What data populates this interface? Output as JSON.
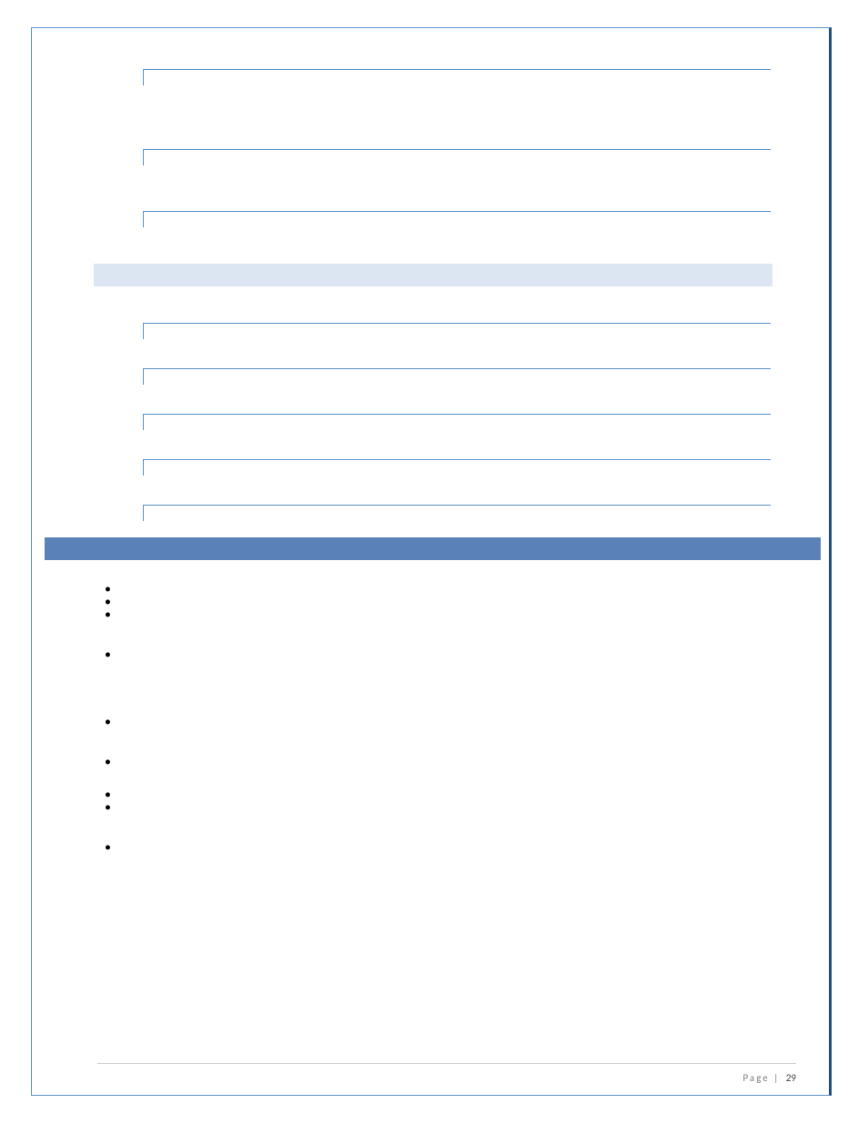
{
  "fields_group_a": [
    {
      "value": ""
    },
    {
      "value": ""
    },
    {
      "value": ""
    }
  ],
  "subheader": {
    "label": ""
  },
  "fields_group_b": [
    {
      "value": ""
    },
    {
      "value": ""
    },
    {
      "value": ""
    },
    {
      "value": ""
    },
    {
      "value": ""
    }
  ],
  "section_header": {
    "label": ""
  },
  "bullets": [
    {
      "text": ""
    },
    {
      "text": ""
    },
    {
      "text": ""
    },
    {
      "text": ""
    },
    {
      "text": ""
    },
    {
      "text": ""
    },
    {
      "text": ""
    },
    {
      "text": ""
    },
    {
      "text": ""
    }
  ],
  "footer": {
    "label": "Page",
    "separator": "|",
    "number": "29"
  }
}
